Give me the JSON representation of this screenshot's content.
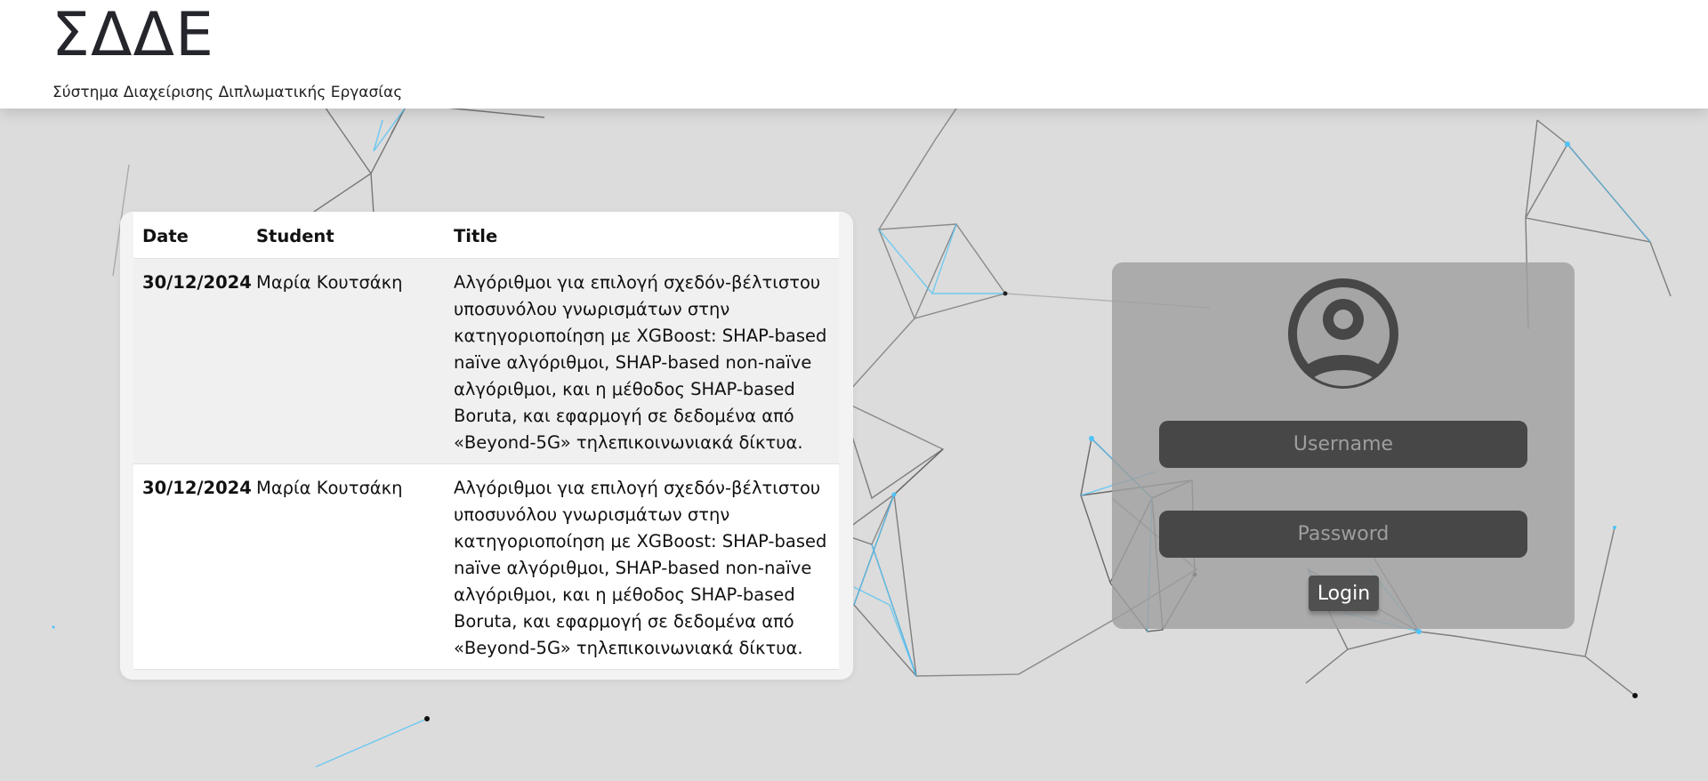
{
  "header": {
    "brand": "ΣΔΔΕ",
    "subtitle": "Σύστημα Διαχείρισης Διπλωματικής Εργασίας"
  },
  "table": {
    "columns": [
      "Date",
      "Student",
      "Title"
    ],
    "rows": [
      {
        "date": "30/12/2024",
        "student": "Μαρία Κουτσάκη",
        "title": "Αλγόριθμοι για επιλογή σχεδόν-βέλτιστου υποσυνόλου γνωρισμάτων στην κατηγοριοποίηση με XGBoost: SHAP-based naïve αλγόριθμοι, SHAP-based non-naïve αλγόριθμοι, και η μέθοδος SHAP-based Boruta, και εφαρμογή σε δεδομένα από «Beyond-5G» τηλεπικοινωνιακά δίκτυα."
      },
      {
        "date": "30/12/2024",
        "student": "Μαρία Κουτσάκη",
        "title": "Αλγόριθμοι για επιλογή σχεδόν-βέλτιστου υποσυνόλου γνωρισμάτων στην κατηγοριοποίηση με XGBoost: SHAP-based naïve αλγόριθμοι, SHAP-based non-naïve αλγόριθμοι, και η μέθοδος SHAP-based Boruta, και εφαρμογή σε δεδομένα από «Beyond-5G» τηλεπικοινωνιακά δίκτυα."
      }
    ]
  },
  "login": {
    "username_placeholder": "Username",
    "password_placeholder": "Password",
    "button_label": "Login",
    "avatar_icon": "user-circle-icon"
  },
  "colors": {
    "header_bg": "#ffffff",
    "page_bg": "#dcdcdc",
    "login_card_bg": "#a0a0a0",
    "field_bg": "#474747",
    "network_accent": "#4fc3f7"
  }
}
